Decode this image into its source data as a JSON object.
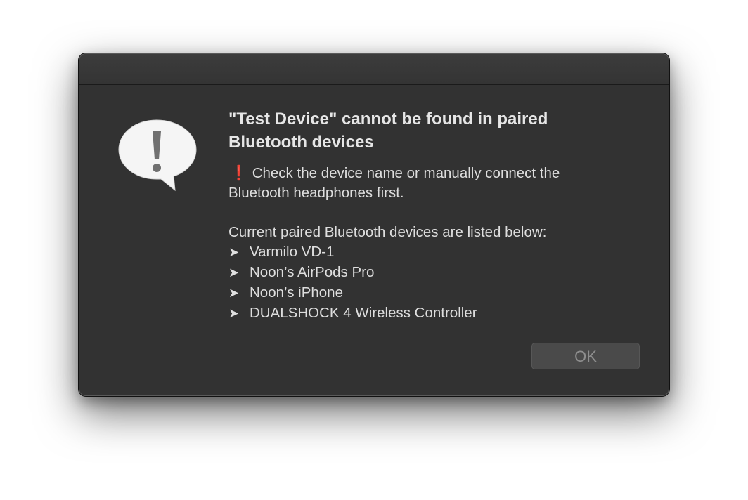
{
  "dialog": {
    "title": "\"Test Device\" cannot be found in paired Bluetooth devices",
    "icon": "alert-caution-icon",
    "warning_glyph": "❗",
    "message_line_1": "Check the device name or manually connect the",
    "message_line_2": "Bluetooth headphones first.",
    "list_intro": "Current paired Bluetooth devices are listed below:",
    "bullet_glyph": "➤",
    "devices": [
      "Varmilo VD-1",
      "Noon’s AirPods Pro",
      "Noon’s iPhone",
      "DUALSHOCK 4 Wireless Controller"
    ],
    "ok_label": "OK"
  },
  "colors": {
    "window_background": "#323232",
    "text": "#dedede",
    "warning": "#ff2d2d",
    "button_disabled_text": "#8e8e8e"
  }
}
